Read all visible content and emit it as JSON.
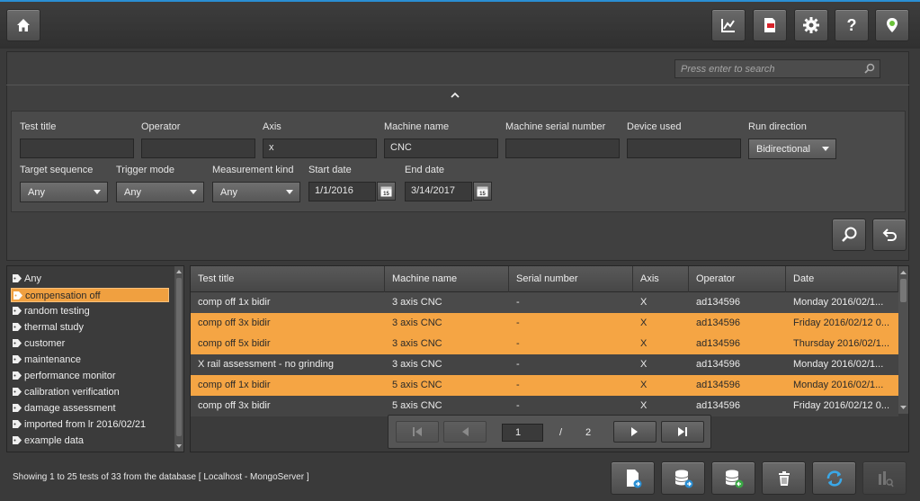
{
  "toolbar": {
    "home_icon": "home-icon",
    "buttons": [
      "chart-icon",
      "report-icon",
      "gear-icon",
      "help-icon",
      "location-pin-icon"
    ]
  },
  "search": {
    "placeholder": "Press enter to search"
  },
  "filters": {
    "test_title_label": "Test title",
    "operator_label": "Operator",
    "axis_label": "Axis",
    "axis_value": "x",
    "machine_name_label": "Machine name",
    "machine_name_value": "CNC",
    "machine_serial_label": "Machine serial number",
    "device_used_label": "Device used",
    "run_direction_label": "Run direction",
    "run_direction_value": "Bidirectional",
    "target_sequence_label": "Target sequence",
    "target_sequence_value": "Any",
    "trigger_mode_label": "Trigger mode",
    "trigger_mode_value": "Any",
    "measurement_kind_label": "Measurement kind",
    "measurement_kind_value": "Any",
    "start_date_label": "Start date",
    "start_date_value": "1/1/2016",
    "end_date_label": "End date",
    "end_date_value": "3/14/2017",
    "calendar_day": "15"
  },
  "tags": [
    {
      "label": "Any",
      "selected": false
    },
    {
      "label": "compensation off",
      "selected": true
    },
    {
      "label": "random testing",
      "selected": false
    },
    {
      "label": "thermal study",
      "selected": false
    },
    {
      "label": "customer",
      "selected": false
    },
    {
      "label": "maintenance",
      "selected": false
    },
    {
      "label": "performance monitor",
      "selected": false
    },
    {
      "label": "calibration verification",
      "selected": false
    },
    {
      "label": "damage assessment",
      "selected": false
    },
    {
      "label": "imported from lr 2016/02/21",
      "selected": false
    },
    {
      "label": "example data",
      "selected": false
    }
  ],
  "grid": {
    "headers": [
      "Test title",
      "Machine name",
      "Serial number",
      "Axis",
      "Operator",
      "Date"
    ],
    "rows": [
      {
        "cells": [
          "comp off 1x bidir",
          "3 axis CNC",
          "-",
          "X",
          "ad134596",
          "Monday 2016/02/1..."
        ],
        "selected": false
      },
      {
        "cells": [
          "comp off 3x bidir",
          "3 axis CNC",
          "-",
          "X",
          "ad134596",
          "Friday 2016/02/12 0..."
        ],
        "selected": true
      },
      {
        "cells": [
          "comp off 5x bidir",
          "3 axis CNC",
          "-",
          "X",
          "ad134596",
          "Thursday 2016/02/1..."
        ],
        "selected": true
      },
      {
        "cells": [
          "X rail assessment - no grinding",
          "3 axis CNC",
          "-",
          "X",
          "ad134596",
          "Monday 2016/02/1..."
        ],
        "selected": false
      },
      {
        "cells": [
          "comp off 1x bidir",
          "5 axis CNC",
          "-",
          "X",
          "ad134596",
          "Monday 2016/02/1..."
        ],
        "selected": true
      },
      {
        "cells": [
          "comp off 3x bidir",
          "5 axis CNC",
          "-",
          "X",
          "ad134596",
          "Friday 2016/02/12 0..."
        ],
        "selected": false
      }
    ]
  },
  "pager": {
    "current_page": "1",
    "separator": "/",
    "total_pages": "2"
  },
  "status": {
    "text": "Showing  1 to 25 tests of 33 from the database  [ Localhost - MongoServer ]"
  },
  "colors": {
    "accent": "#2a8fd4",
    "selection": "#f5a544"
  }
}
